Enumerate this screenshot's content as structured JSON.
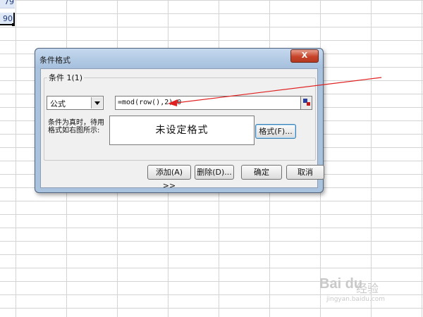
{
  "sheet": {
    "cells": [
      "79",
      "90"
    ]
  },
  "dialog": {
    "title": "条件格式",
    "close_label": "X",
    "condition_label": "条件 1(1)",
    "type_value": "公式",
    "formula_value": "=mod(row(),2)=0",
    "hint_text": "条件为真时，待用格式如右图所示:",
    "preview_text": "未设定格式",
    "format_button": "格式(F)...",
    "add_button": "添加(A) >>",
    "delete_button": "删除(D)...",
    "ok_button": "确定",
    "cancel_button": "取消"
  },
  "annotation": {
    "arrow_color": "#e02020"
  },
  "watermark": {
    "logo": "Bai du",
    "sub": "经验",
    "url": "jingyan.baidu.com"
  }
}
